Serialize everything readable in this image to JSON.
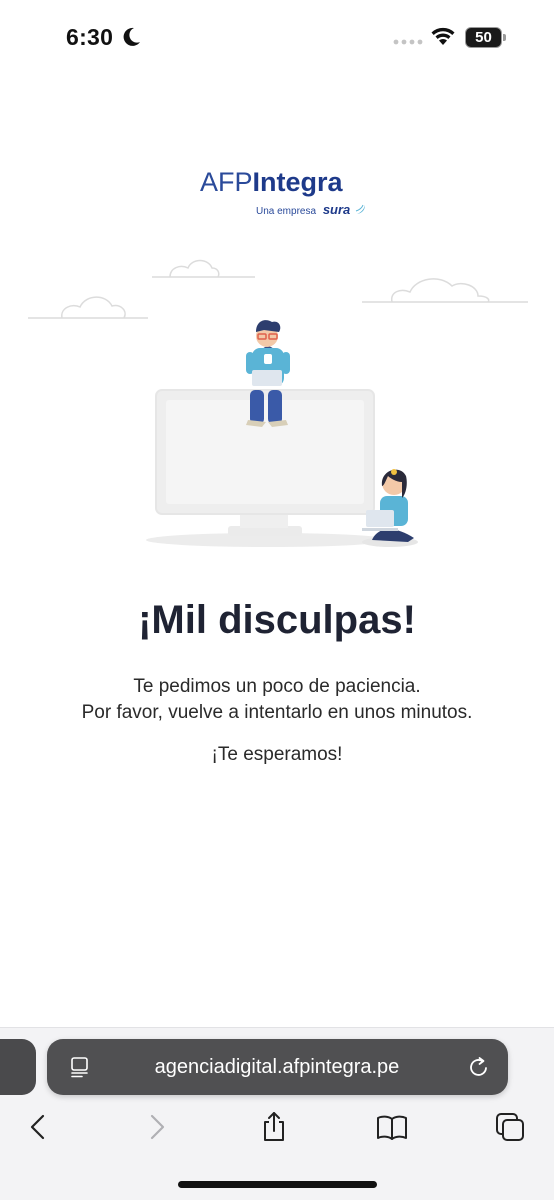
{
  "status_bar": {
    "time": "6:30",
    "battery_level": "50",
    "icons": [
      "moon-icon",
      "signal-dots-icon",
      "wifi-icon",
      "battery-icon"
    ]
  },
  "logo": {
    "afp": "AFP",
    "integra": "Integra",
    "tagline": "Una empresa",
    "sura": "sura",
    "brand_color": "#1e3a8a"
  },
  "message": {
    "heading": "¡Mil disculpas!",
    "line1": "Te pedimos un poco de paciencia.",
    "line2": "Por favor, vuelve a intentarlo en unos minutos.",
    "closing": "¡Te esperamos!"
  },
  "browser": {
    "url": "agenciadigital.afpintegra.pe",
    "toolbar_icons": [
      "back-icon",
      "forward-icon",
      "share-icon",
      "bookmarks-icon",
      "tabs-icon"
    ],
    "address_bar_icons": [
      "reader-mode-icon",
      "reload-icon"
    ]
  },
  "colors": {
    "accent": "#5ab4d6",
    "heading": "#1f2333",
    "address_bar": "#505052"
  }
}
